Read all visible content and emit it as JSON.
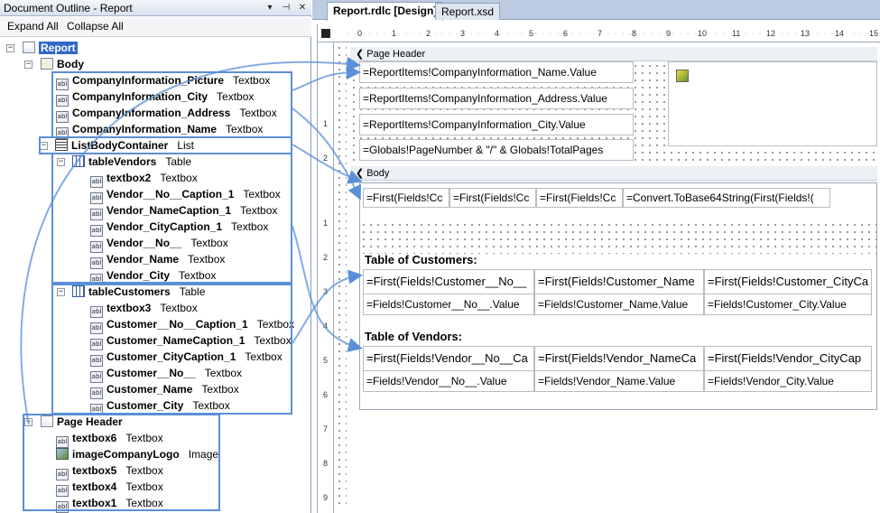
{
  "outline": {
    "title": "Document Outline - Report",
    "pin_glyph": "▾",
    "pushpin_glyph": "⊣",
    "close_glyph": "✕",
    "expand_all": "Expand All",
    "collapse_all": "Collapse All",
    "report": "Report",
    "body": "Body",
    "body_items": [
      {
        "name": "CompanyInformation_Picture",
        "type": "Textbox"
      },
      {
        "name": "CompanyInformation_City",
        "type": "Textbox"
      },
      {
        "name": "CompanyInformation_Address",
        "type": "Textbox"
      },
      {
        "name": "CompanyInformation_Name",
        "type": "Textbox"
      }
    ],
    "list": {
      "name": "ListBodyContainer",
      "type": "List"
    },
    "table_vendors": {
      "name": "tableVendors",
      "type": "Table"
    },
    "vendor_items": [
      {
        "name": "textbox2",
        "type": "Textbox"
      },
      {
        "name": "Vendor__No__Caption_1",
        "type": "Textbox"
      },
      {
        "name": "Vendor_NameCaption_1",
        "type": "Textbox"
      },
      {
        "name": "Vendor_CityCaption_1",
        "type": "Textbox"
      },
      {
        "name": "Vendor__No__",
        "type": "Textbox"
      },
      {
        "name": "Vendor_Name",
        "type": "Textbox"
      },
      {
        "name": "Vendor_City",
        "type": "Textbox"
      }
    ],
    "table_customers": {
      "name": "tableCustomers",
      "type": "Table"
    },
    "customer_items": [
      {
        "name": "textbox3",
        "type": "Textbox"
      },
      {
        "name": "Customer__No__Caption_1",
        "type": "Textbox"
      },
      {
        "name": "Customer_NameCaption_1",
        "type": "Textbox"
      },
      {
        "name": "Customer_CityCaption_1",
        "type": "Textbox"
      },
      {
        "name": "Customer__No__",
        "type": "Textbox"
      },
      {
        "name": "Customer_Name",
        "type": "Textbox"
      },
      {
        "name": "Customer_City",
        "type": "Textbox"
      }
    ],
    "page_header": "Page Header",
    "header_items": [
      {
        "name": "textbox6",
        "type": "Textbox"
      },
      {
        "name": "imageCompanyLogo",
        "type": "Image"
      },
      {
        "name": "textbox5",
        "type": "Textbox"
      },
      {
        "name": "textbox4",
        "type": "Textbox"
      },
      {
        "name": "textbox1",
        "type": "Textbox"
      }
    ]
  },
  "designer": {
    "tabs": [
      "Report.rdlc [Design]",
      "Report.xsd"
    ],
    "ruler_top": [
      "0",
      "1",
      "2",
      "3",
      "4",
      "5",
      "6",
      "7",
      "8",
      "9",
      "10",
      "11",
      "12",
      "13",
      "14",
      "15"
    ],
    "ruler_left_header": [
      "1",
      "2"
    ],
    "ruler_left_body": [
      "1",
      "2",
      "3",
      "4",
      "5",
      "6",
      "7",
      "8",
      "9"
    ],
    "page_header_band": "Page Header",
    "body_band": "Body",
    "header_cells": [
      "=ReportItems!CompanyInformation_Name.Value",
      "=ReportItems!CompanyInformation_Address.Value",
      "=ReportItems!CompanyInformation_City.Value",
      "=Globals!PageNumber & \"/\" & Globals!TotalPages"
    ],
    "list_cells": [
      "=First(Fields!Cc",
      "=First(Fields!Cc",
      "=First(Fields!Cc",
      "=Convert.ToBase64String(First(Fields!("
    ],
    "customers_title": "Table of Customers:",
    "customers_header": [
      "=First(Fields!Customer__No__",
      "=First(Fields!Customer_Name",
      "=First(Fields!Customer_CityCa"
    ],
    "customers_detail": [
      "=Fields!Customer__No__.Value",
      "=Fields!Customer_Name.Value",
      "=Fields!Customer_City.Value"
    ],
    "vendors_title": "Table of Vendors:",
    "vendors_header": [
      "=First(Fields!Vendor__No__Ca",
      "=First(Fields!Vendor_NameCa",
      "=First(Fields!Vendor_CityCap"
    ],
    "vendors_detail": [
      "=Fields!Vendor__No__.Value",
      "=Fields!Vendor_Name.Value",
      "=Fields!Vendor_City.Value"
    ]
  },
  "colors": {
    "callout": "#5b8fd8",
    "selection": "#3168c8"
  }
}
